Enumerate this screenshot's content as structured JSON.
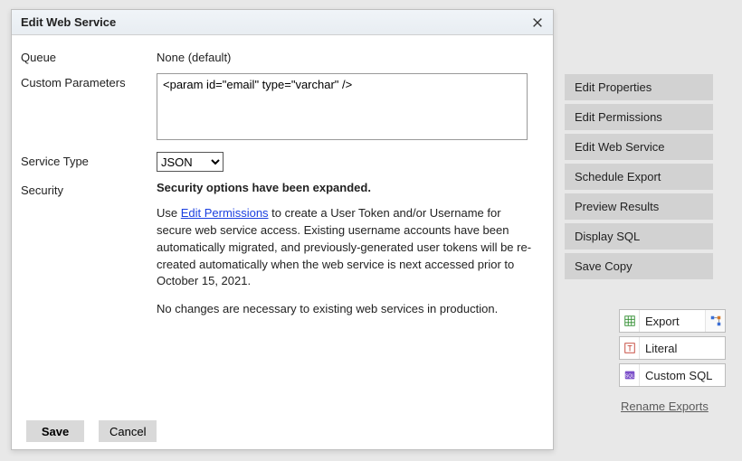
{
  "dialog": {
    "title": "Edit Web Service",
    "labels": {
      "queue": "Queue",
      "custom_params": "Custom Parameters",
      "service_type": "Service Type",
      "security": "Security"
    },
    "queue_value": "None (default)",
    "custom_params_value": "<param id=\"email\" type=\"varchar\" />",
    "service_type_value": "JSON",
    "service_type_options": [
      "JSON"
    ],
    "security": {
      "heading": "Security options have been expanded.",
      "p1_pre": "Use ",
      "p1_link": "Edit Permissions",
      "p1_post": " to create a User Token and/or Username for secure web service access. Existing username accounts have been automatically migrated, and previously-generated user tokens will be re-created automatically when the web service is next accessed prior to October 15, 2021.",
      "p2": "No changes are necessary to existing web services in production."
    },
    "buttons": {
      "save": "Save",
      "cancel": "Cancel"
    }
  },
  "side_menu": [
    "Edit Properties",
    "Edit Permissions",
    "Edit Web Service",
    "Schedule Export",
    "Preview Results",
    "Display SQL",
    "Save Copy"
  ],
  "tools": {
    "export": "Export",
    "literal": "Literal",
    "custom_sql": "Custom SQL",
    "rename": "Rename Exports"
  }
}
